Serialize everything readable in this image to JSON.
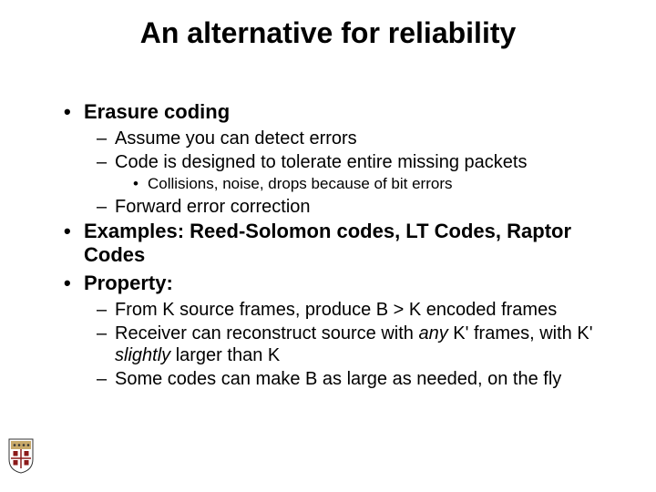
{
  "title": "An alternative for reliability",
  "b1": {
    "label": "Erasure coding"
  },
  "b1s": {
    "a": "Assume you can detect errors",
    "b": "Code is designed to tolerate entire missing packets",
    "b_sub": "Collisions, noise, drops because of bit errors",
    "c": "Forward error correction"
  },
  "b2": {
    "label": "Examples: Reed-Solomon codes, LT Codes, Raptor Codes"
  },
  "b3": {
    "label": "Property:"
  },
  "b3s": {
    "a": "From K source frames, produce B > K encoded frames",
    "b_pre": "Receiver can reconstruct source with ",
    "b_em1": "any",
    "b_mid": " K' frames, with K' ",
    "b_em2": "slightly",
    "b_post": " larger than K",
    "c": "Some codes can make B as large as needed, on the fly"
  },
  "glyphs": {
    "bullet": "•",
    "dash": "–",
    "dot": "•"
  }
}
